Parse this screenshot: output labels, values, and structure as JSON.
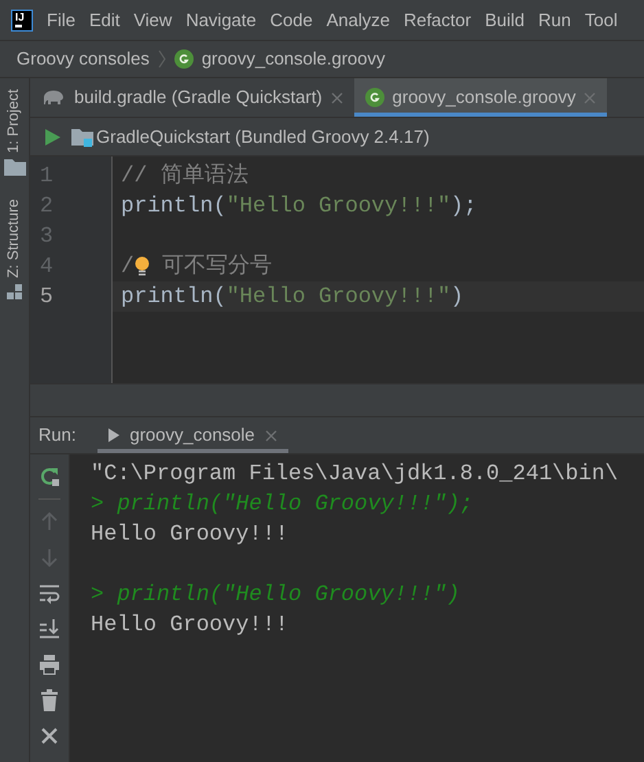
{
  "logo": "IJ",
  "menu": [
    "File",
    "Edit",
    "View",
    "Navigate",
    "Code",
    "Analyze",
    "Refactor",
    "Build",
    "Run",
    "Tool"
  ],
  "breadcrumbs": [
    {
      "label": "Groovy consoles",
      "kind": "folder"
    },
    {
      "label": "groovy_console.groovy",
      "kind": "groovy"
    }
  ],
  "side_tools": [
    {
      "label": "1: Project",
      "kind": "folder"
    },
    {
      "label": "Z: Structure",
      "kind": "structure"
    }
  ],
  "tabs": [
    {
      "label": "build.gradle (Gradle Quickstart)",
      "kind": "gradle",
      "selected": false
    },
    {
      "label": "groovy_console.groovy",
      "kind": "groovy",
      "selected": true
    }
  ],
  "run_config": "GradleQuickstart (Bundled Groovy 2.4.17)",
  "editor": {
    "lines": [
      {
        "number": "1",
        "current": false,
        "tokens": [
          {
            "kind": "comment",
            "text": "// 简单语法"
          }
        ]
      },
      {
        "number": "2",
        "current": false,
        "tokens": [
          {
            "kind": "plain",
            "text": "println("
          },
          {
            "kind": "string",
            "text": "\"Hello Groovy!!!\""
          },
          {
            "kind": "plain",
            "text": ");"
          }
        ]
      },
      {
        "number": "3",
        "current": false
      },
      {
        "number": "4",
        "current": false,
        "tokens": [
          {
            "kind": "comment",
            "text": "/"
          },
          {
            "kind": "bulb"
          },
          {
            "kind": "comment",
            "text": " 可不写分号"
          }
        ]
      },
      {
        "number": "5",
        "current": true,
        "tokens": [
          {
            "kind": "plain",
            "text": "println("
          },
          {
            "kind": "string",
            "text": "\"Hello Groovy!!!\""
          },
          {
            "kind": "plain",
            "text": ")"
          }
        ]
      }
    ]
  },
  "run_panel": {
    "label": "Run:",
    "tab": "groovy_console",
    "tools": [
      {
        "kind": "rerun",
        "disabled": false
      },
      {
        "kind": "up",
        "disabled": true
      },
      {
        "kind": "down",
        "disabled": true
      },
      {
        "kind": "wrap",
        "disabled": false
      },
      {
        "kind": "scroll-end",
        "disabled": false
      },
      {
        "kind": "print",
        "disabled": false
      },
      {
        "kind": "trash",
        "disabled": false
      },
      {
        "kind": "close",
        "disabled": false
      }
    ],
    "output": [
      {
        "kind": "command",
        "text": "\"C:\\Program Files\\Java\\jdk1.8.0_241\\bin\\"
      },
      {
        "kind": "input",
        "text": "> println(\"Hello Groovy!!!\");"
      },
      {
        "kind": "output",
        "text": "Hello Groovy!!!"
      },
      {
        "kind": "blank"
      },
      {
        "kind": "input",
        "text": "> println(\"Hello Groovy!!!\")"
      },
      {
        "kind": "output",
        "text": "Hello Groovy!!!"
      }
    ]
  }
}
